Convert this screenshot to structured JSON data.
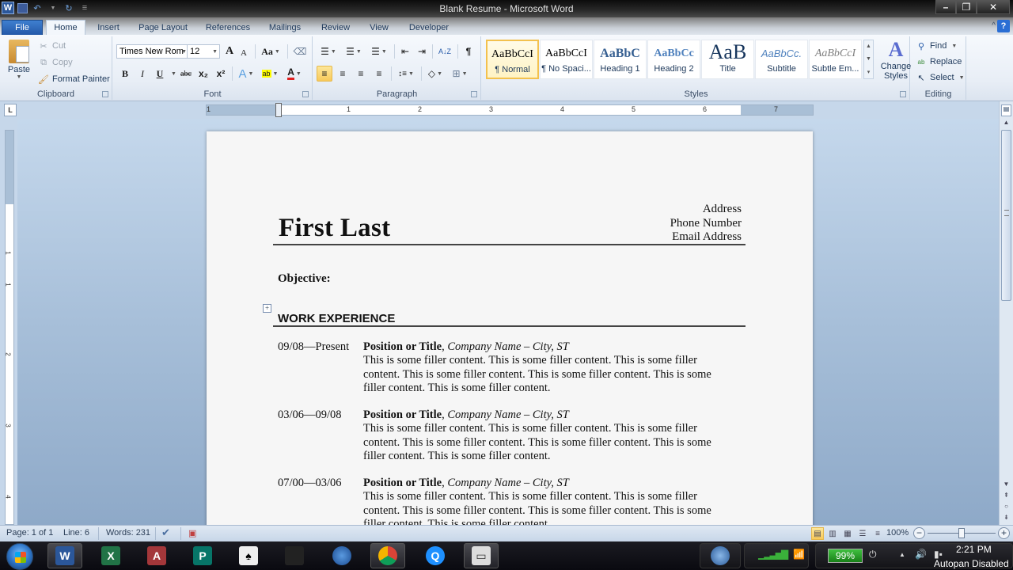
{
  "window": {
    "title": "Blank Resume - Microsoft Word",
    "qat": {
      "app_icon": "word-icon",
      "save": "save-icon",
      "undo": "undo-icon",
      "redo": "redo-icon",
      "customize": "customize-qat-icon"
    },
    "controls": {
      "minimize": "–",
      "restore": "❐",
      "close": "✕"
    }
  },
  "tabs": [
    {
      "label": "File"
    },
    {
      "label": "Home"
    },
    {
      "label": "Insert"
    },
    {
      "label": "Page Layout"
    },
    {
      "label": "References"
    },
    {
      "label": "Mailings"
    },
    {
      "label": "Review"
    },
    {
      "label": "View"
    },
    {
      "label": "Developer"
    }
  ],
  "ribbon": {
    "clipboard": {
      "label": "Clipboard",
      "paste": "Paste",
      "cut": "Cut",
      "copy": "Copy",
      "format_painter": "Format Painter"
    },
    "font": {
      "label": "Font",
      "font_name": "Times New Rom",
      "font_size": "12",
      "grow": "A",
      "shrink": "A",
      "change_case": "Aa",
      "clear_formatting": "clear-formatting-icon",
      "bold": "B",
      "italic": "I",
      "underline": "U",
      "strikethrough": "abc",
      "subscript": "x₂",
      "superscript": "x²",
      "text_effects": "A",
      "highlight": "ab",
      "font_color": "A",
      "font_color_hex": "#e02020",
      "highlight_hex": "#ffff00"
    },
    "paragraph": {
      "label": "Paragraph",
      "bullets": "☰",
      "numbering": "☰",
      "multilevel": "☰",
      "decrease_indent": "⇤",
      "increase_indent": "⇥",
      "sort": "A↓Z",
      "show_marks": "¶",
      "align_left": "≡",
      "center": "≡",
      "align_right": "≡",
      "justify": "≡",
      "line_spacing": "↕≡",
      "shading": "◇",
      "borders": "⊞"
    },
    "styles": {
      "label": "Styles",
      "items": [
        {
          "sample": "AaBbCcI",
          "name": "¶ Normal",
          "selected": true
        },
        {
          "sample": "AaBbCcI",
          "name": "¶ No Spaci...",
          "selected": false
        },
        {
          "sample": "AaBbC",
          "name": "Heading 1",
          "selected": false
        },
        {
          "sample": "AaBbCc",
          "name": "Heading 2",
          "selected": false
        },
        {
          "sample": "AaB",
          "name": "Title",
          "selected": false
        },
        {
          "sample": "AaBbCc.",
          "name": "Subtitle",
          "selected": false
        },
        {
          "sample": "AaBbCcI",
          "name": "Subtle Em...",
          "selected": false
        }
      ],
      "change_styles": "Change Styles"
    },
    "editing": {
      "label": "Editing",
      "find": "Find",
      "replace": "Replace",
      "select": "Select"
    }
  },
  "ruler": {
    "tab_selector": "L",
    "numbers": [
      "1",
      "1",
      "2",
      "3",
      "4",
      "5",
      "6",
      "7"
    ],
    "vertical_numbers": [
      "1",
      "1",
      "2",
      "3",
      "4"
    ]
  },
  "document": {
    "contact": [
      "Address",
      "Phone Number",
      "Email Address"
    ],
    "name": "First Last",
    "objective": "Objective:",
    "section_heading": "WORK EXPERIENCE",
    "jobs": [
      {
        "dates": "09/08—Present",
        "title": "Position or Title",
        "company": "Company Name – City, ST",
        "body": "This is some filler content. This is some filler content. This is some filler content. This is some filler content. This is some filler content. This is some filler content. This is some filler content."
      },
      {
        "dates": "03/06—09/08",
        "title": "Position or Title",
        "company": "Company Name – City, ST",
        "body": "This is some filler content. This is some filler content. This is some filler content. This is some filler content. This is some filler content. This is some filler content. This is some filler content."
      },
      {
        "dates": "07/00—03/06",
        "title": "Position or Title",
        "company": "Company Name – City, ST",
        "body": "This is some filler content. This is some filler content. This is some filler content. This is some filler content. This is some filler content. This is some filler content. This is some filler content."
      }
    ]
  },
  "statusbar": {
    "page": "Page: 1 of 1",
    "line": "Line: 6",
    "words": "Words: 231",
    "zoom": "100%",
    "zoom_level_percent": 100
  },
  "taskbar": {
    "apps": [
      "Microsoft Word",
      "Microsoft Excel",
      "Microsoft Access",
      "Microsoft Publisher",
      "Solitaire",
      "Unknown App",
      "Google Earth",
      "Google Chrome",
      "QuickTime",
      "Explorer"
    ],
    "battery": "99%",
    "clock": "2:21 PM",
    "notice": "Autopan Disabled"
  }
}
